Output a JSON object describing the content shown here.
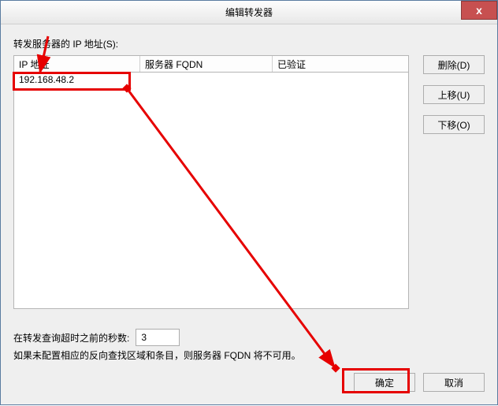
{
  "window": {
    "title": "编辑转发器",
    "close_icon": "x"
  },
  "labels": {
    "forwarder_ip_list": "转发服务器的 IP 地址(S):",
    "timeout_label": "在转发查询超时之前的秒数:",
    "note": "如果未配置相应的反向查找区域和条目，则服务器 FQDN 将不可用。"
  },
  "table": {
    "headers": {
      "ip": "IP 地址",
      "fqdn": "服务器 FQDN",
      "verified": "已验证"
    },
    "rows": [
      {
        "ip": "192.168.48.2",
        "fqdn": "",
        "verified": ""
      }
    ]
  },
  "side_buttons": {
    "delete": "删除(D)",
    "move_up": "上移(U)",
    "move_down": "下移(O)"
  },
  "timeout_value": "3",
  "bottom_buttons": {
    "ok": "确定",
    "cancel": "取消"
  }
}
